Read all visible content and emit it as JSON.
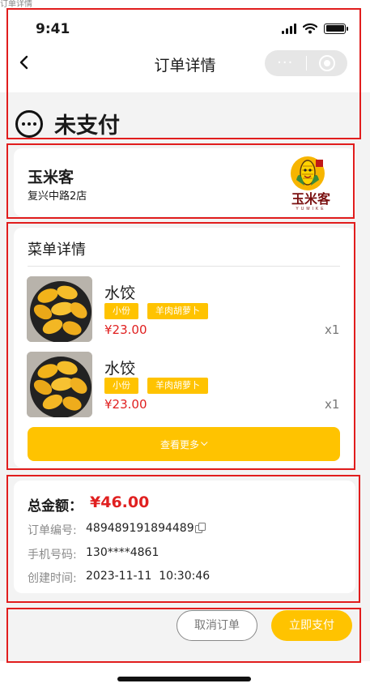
{
  "doc_label": "订单详情",
  "status_bar": {
    "time": "9:41"
  },
  "nav": {
    "title": "订单详情",
    "capsule_more": "···"
  },
  "order_status": {
    "text": "未支付"
  },
  "store": {
    "name": "玉米客",
    "address": "复兴中路2店",
    "logo_text": "玉米客",
    "logo_subtext": "YUMIKE"
  },
  "menu": {
    "title": "菜单详情",
    "items": [
      {
        "name": "水饺",
        "tags": [
          "小份",
          "羊肉胡萝卜"
        ],
        "price": "¥23.00",
        "qty": "x1"
      },
      {
        "name": "水饺",
        "tags": [
          "小份",
          "羊肉胡萝卜"
        ],
        "price": "¥23.00",
        "qty": "x1"
      }
    ],
    "more_label": "查看更多"
  },
  "summary": {
    "total_label": "总金额：",
    "total_value": "¥46.00",
    "order_no_label": "订单编号:",
    "order_no": "489489191894489",
    "phone_label": "手机号码:",
    "phone": "130****4861",
    "created_label": "创建时间:",
    "created": "2023-11-11  10:30:46"
  },
  "actions": {
    "cancel": "取消订单",
    "pay": "立即支付"
  },
  "colors": {
    "accent": "#ffc300",
    "price": "#e02020",
    "background": "#f3f3f3",
    "highlight_frame": "#e11d1d"
  }
}
